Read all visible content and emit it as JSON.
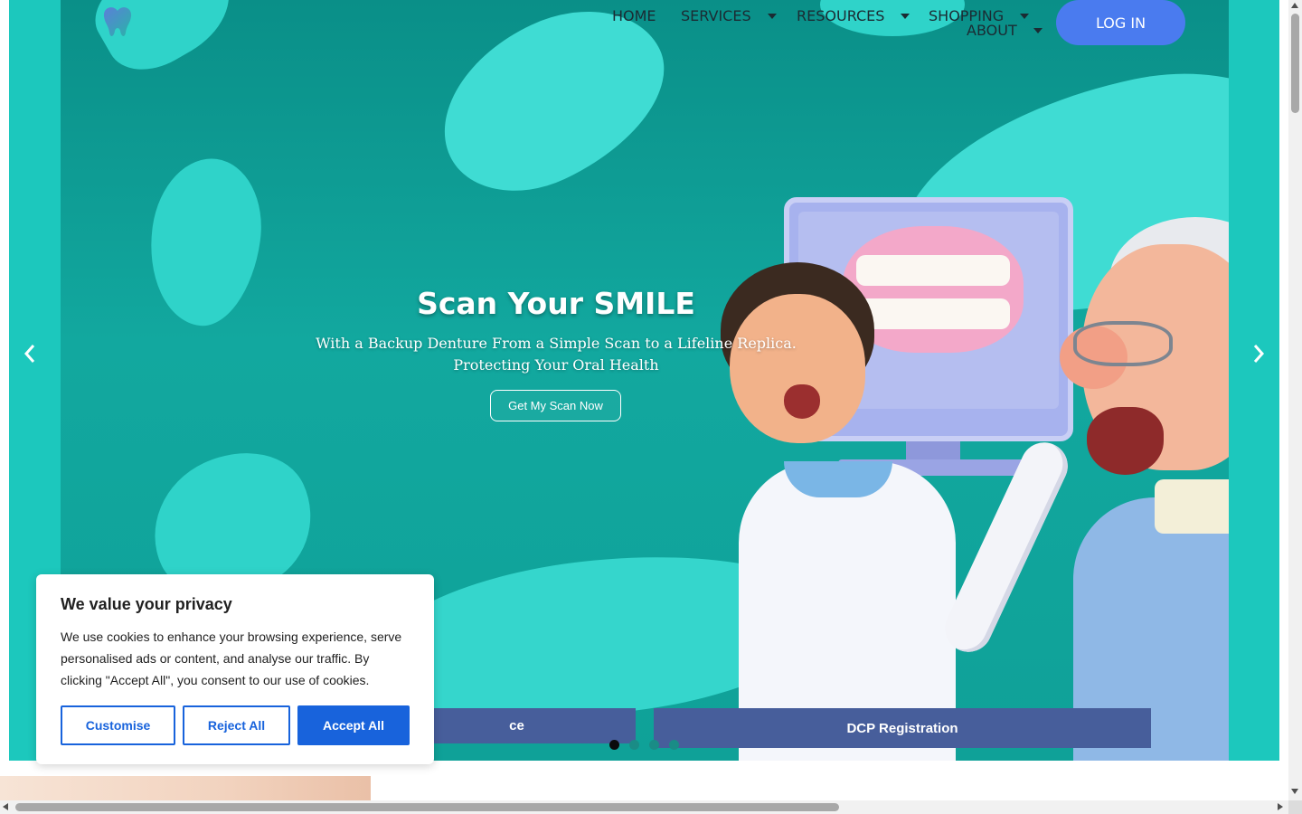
{
  "header": {
    "nav": {
      "home": "HOME",
      "services": "SERVICES",
      "resources": "RESOURCES",
      "shopping": "SHOPPING",
      "about": "ABOUT"
    },
    "login_label": "LOG IN",
    "logo_icon": "tooth-heart-icon"
  },
  "hero": {
    "title": "Scan Your SMILE",
    "subtitle_line1": "With a Backup Denture From a Simple Scan to a Lifeline Replica.",
    "subtitle_line2": "Protecting Your Oral Health",
    "cta_label": "Get My Scan Now",
    "prev_icon": "chevron-left-icon",
    "next_icon": "chevron-right-icon",
    "bar_left_label": "ce",
    "bar_right_label": "DCP Registration",
    "slide_count": 4,
    "active_slide": 1
  },
  "cookie_banner": {
    "title": "We value your privacy",
    "text": "We use cookies to enhance your browsing experience, serve personalised ads or content, and analyse our traffic. By clicking \"Accept All\", you consent to our use of cookies.",
    "customise_label": "Customise",
    "reject_label": "Reject All",
    "accept_label": "Accept All"
  },
  "colors": {
    "teal_bg": "#1cc8bd",
    "slide_dark": "#0a8f88",
    "login_blue": "#4a7bef",
    "bar_blue": "#475e9b",
    "cookie_blue": "#1863dc"
  }
}
